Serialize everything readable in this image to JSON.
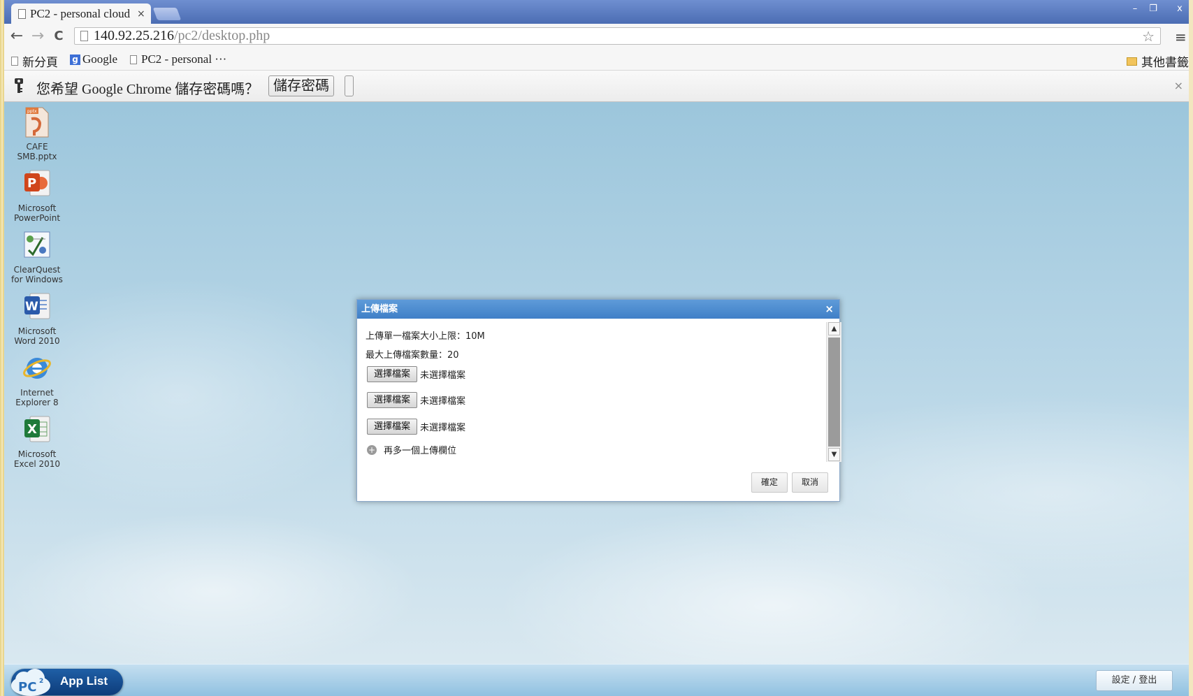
{
  "browser": {
    "tab_title": "PC2 - personal cloud",
    "tab_close": "×",
    "url_host": "140.92.25.216",
    "url_path": "/pc2/desktop.php",
    "back": "←",
    "forward": "→",
    "reload": "C",
    "star": "☆",
    "menu": "≡",
    "win_min": "–",
    "win_max": "❐",
    "win_close": "x"
  },
  "bookmarks": {
    "items": [
      "新分頁",
      "Google",
      "PC2 - personal ···"
    ],
    "other": "其他書籤"
  },
  "infobar": {
    "text": "您希望 Google Chrome 儲存密碼嗎？",
    "save_button": "儲存密碼",
    "close": "×"
  },
  "desktop": {
    "icons": [
      {
        "line1": "CAFE",
        "line2": "SMB.pptx",
        "icon": "pptx-file-icon"
      },
      {
        "line1": "Microsoft",
        "line2": "PowerPoint",
        "icon": "powerpoint-icon"
      },
      {
        "line1": "ClearQuest",
        "line2": "for Windows",
        "icon": "clearquest-icon"
      },
      {
        "line1": "Microsoft",
        "line2": "Word 2010",
        "icon": "word-icon"
      },
      {
        "line1": "Internet",
        "line2": "Explorer 8",
        "icon": "ie-icon"
      },
      {
        "line1": "Microsoft",
        "line2": "Excel 2010",
        "icon": "excel-icon"
      }
    ]
  },
  "dialog": {
    "title": "上傳檔案",
    "close": "×",
    "size_limit": "上傳單一檔案大小上限：10M",
    "max_files": "最大上傳檔案數量：20",
    "choose_label": "選擇檔案",
    "no_file": "未選擇檔案",
    "add_field": "再多一個上傳欄位",
    "ok": "確定",
    "cancel": "取消"
  },
  "taskbar": {
    "app_list": "App List",
    "settings": "設定 / 登出"
  }
}
